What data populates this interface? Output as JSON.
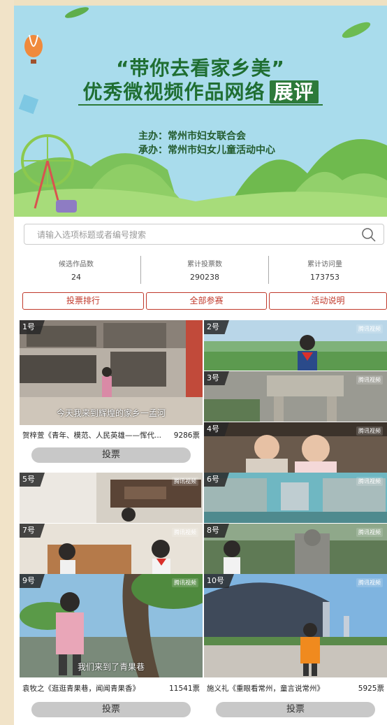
{
  "banner": {
    "title_line1": "“带你去看家乡美”",
    "title_line2": "优秀微视频作品网络",
    "title_badge": "展评",
    "host": "主办：常州市妇女联合会",
    "organizer": "承办：常州市妇女儿童活动中心"
  },
  "search": {
    "placeholder": "请输入选项标题或者编号搜索"
  },
  "stats": [
    {
      "label": "候选作品数",
      "value": "24"
    },
    {
      "label": "累计投票数",
      "value": "290238"
    },
    {
      "label": "累计访问量",
      "value": "173753"
    }
  ],
  "tabs": [
    "投票排行",
    "全部参赛",
    "活动说明"
  ],
  "vote_label": "投票",
  "logo_text": "腾讯视频",
  "entries": [
    {
      "num": "1号",
      "caption": "贺梓萱《青年、模范、人民英雄——恽代...",
      "votes": "9286票",
      "subtitle": "今天我来到辉煌的家乡一孟河"
    },
    {
      "num": "2号"
    },
    {
      "num": "3号"
    },
    {
      "num": "4号"
    },
    {
      "num": "5号"
    },
    {
      "num": "6号"
    },
    {
      "num": "7号"
    },
    {
      "num": "8号"
    },
    {
      "num": "9号",
      "caption": "袁牧之《逛逛青果巷，闻闻青果香》",
      "votes": "11541票",
      "subtitle": "我们来到了青果巷"
    },
    {
      "num": "10号",
      "caption": "施义礼《重眼看常州，童言说常州》",
      "votes": "5925票"
    }
  ],
  "colors": {
    "accent": "#c0392b",
    "banner_green": "#2d7a3a",
    "sky": "#a9dcec"
  }
}
